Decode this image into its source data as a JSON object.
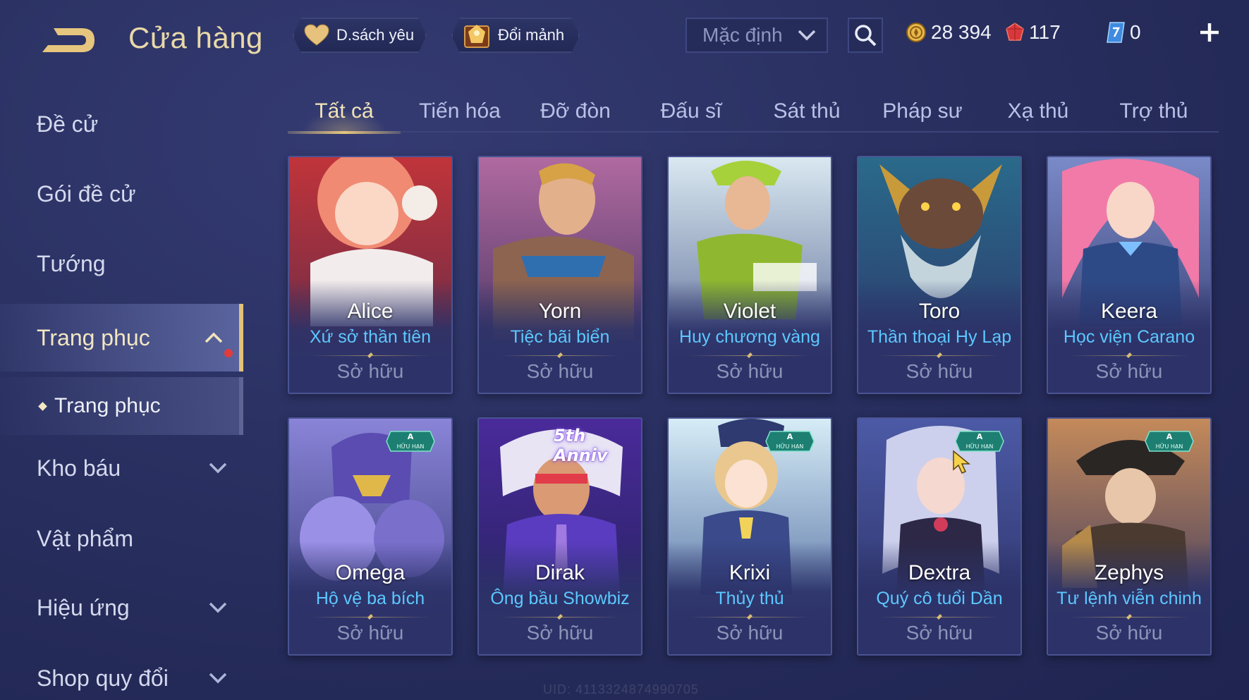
{
  "header": {
    "title": "Cửa hàng",
    "back_icon": "back-arrow-icon",
    "favorites_label": "D.sách yêu",
    "fragments_label": "Đổi mảnh",
    "sort_value": "Mặc định",
    "currencies": {
      "gold": "28 394",
      "ruby": "117",
      "voucher": "0"
    }
  },
  "sidebar": {
    "items": [
      {
        "label": "Đề cử"
      },
      {
        "label": "Gói đề cử"
      },
      {
        "label": "Tướng"
      },
      {
        "label": "Trang phục"
      },
      {
        "label": "Kho báu"
      },
      {
        "label": "Vật phẩm"
      },
      {
        "label": "Hiệu ứng"
      },
      {
        "label": "Shop quy đổi"
      }
    ],
    "sub_item": {
      "label": "Trang phục"
    }
  },
  "tabs": [
    {
      "label": "Tất cả"
    },
    {
      "label": "Tiến hóa"
    },
    {
      "label": "Đỡ đòn"
    },
    {
      "label": "Đấu sĩ"
    },
    {
      "label": "Sát thủ"
    },
    {
      "label": "Pháp sư"
    },
    {
      "label": "Xạ thủ"
    },
    {
      "label": "Trợ thủ"
    }
  ],
  "cards": [
    {
      "hero": "Alice",
      "skin": "Xứ sở thần tiên",
      "status": "Sở hữu"
    },
    {
      "hero": "Yorn",
      "skin": "Tiệc bãi biển",
      "status": "Sở hữu"
    },
    {
      "hero": "Violet",
      "skin": "Huy chương vàng",
      "status": "Sở hữu"
    },
    {
      "hero": "Toro",
      "skin": "Thần thoại Hy Lạp",
      "status": "Sở hữu"
    },
    {
      "hero": "Keera",
      "skin": "Học viện Carano",
      "status": "Sở hữu"
    },
    {
      "hero": "Omega",
      "skin": "Hộ vệ ba bích",
      "status": "Sở hữu"
    },
    {
      "hero": "Dirak",
      "skin": "Ông bầu Showbiz",
      "status": "Sở hữu"
    },
    {
      "hero": "Krixi",
      "skin": "Thủy thủ",
      "status": "Sở hữu"
    },
    {
      "hero": "Dextra",
      "skin": "Quý cô tuổi Dần",
      "status": "Sở hữu"
    },
    {
      "hero": "Zephys",
      "skin": "Tư lệnh viễn chinh",
      "status": "Sở hữu"
    }
  ],
  "badges": {
    "limited_label": "HỮU HẠN",
    "grade": "A",
    "anniversary": "5th Anniv"
  },
  "footer": {
    "uid": "UID: 4113324874990705"
  },
  "colors": {
    "background": "#272d5c",
    "accent_gold": "#e6c67e",
    "skin_name": "#5cc8ff",
    "owned_text": "#8d94b8"
  }
}
